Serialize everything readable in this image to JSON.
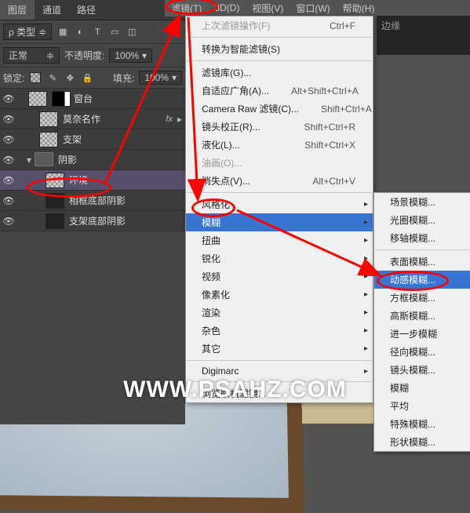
{
  "menubar": {
    "filter": "滤镜(T)",
    "threeD": "3D(D)",
    "view": "视图(V)",
    "window": "窗口(W)",
    "help": "帮助(H)"
  },
  "panel": {
    "tabs": {
      "layers": "图层",
      "channels": "通道",
      "paths": "路径"
    },
    "kind": "ρ 类型",
    "blend": "正常",
    "opacityLabel": "不透明度:",
    "opacityVal": "100%",
    "lockLabel": "锁定:",
    "fillLabel": "填充:",
    "fillVal": "100%"
  },
  "layers": {
    "l0": "窗台",
    "l1": "莫奈名作",
    "l2": "支架",
    "grp": "阴影",
    "l3": "环境",
    "l4": "相框底部阴影",
    "l5": "支架底部阴影"
  },
  "fx": "fx",
  "filterMenu": {
    "last": "上次滤镜操作(F)",
    "lastKey": "Ctrl+F",
    "smart": "转换为智能滤镜(S)",
    "gallery": "滤镜库(G)...",
    "adaptive": "自适应广角(A)...",
    "adaptiveKey": "Alt+Shift+Ctrl+A",
    "cameraRaw": "Camera Raw 滤镜(C)...",
    "cameraRawKey": "Shift+Ctrl+A",
    "lens": "镜头校正(R)...",
    "lensKey": "Shift+Ctrl+R",
    "liquify": "液化(L)...",
    "liquifyKey": "Shift+Ctrl+X",
    "oil": "油画(O)...",
    "vanish": "消失点(V)...",
    "vanishKey": "Alt+Ctrl+V",
    "stylize": "风格化",
    "blur": "模糊",
    "distort": "扭曲",
    "sharpen": "锐化",
    "video": "视频",
    "pixelate": "像素化",
    "render": "渲染",
    "noise": "杂色",
    "other": "其它",
    "digimarc": "Digimarc",
    "browse": "浏览联机滤镜..."
  },
  "blurMenu": {
    "field": "场景模糊...",
    "iris": "光圈模糊...",
    "tilt": "移轴模糊...",
    "surface": "表面模糊...",
    "motion": "动感模糊...",
    "box": "方框模糊...",
    "gaussian": "高斯模糊...",
    "more": "进一步模糊",
    "radial": "径向模糊...",
    "lensb": "镜头模糊...",
    "plain": "模糊",
    "average": "平均",
    "special": "特殊模糊...",
    "shape": "形状模糊..."
  },
  "sidebarExtra": "边缘",
  "watermark": "WWW.PSAHZ.COM",
  "colors": {
    "highlight": "#3874d1",
    "annot": "#ff0000"
  }
}
